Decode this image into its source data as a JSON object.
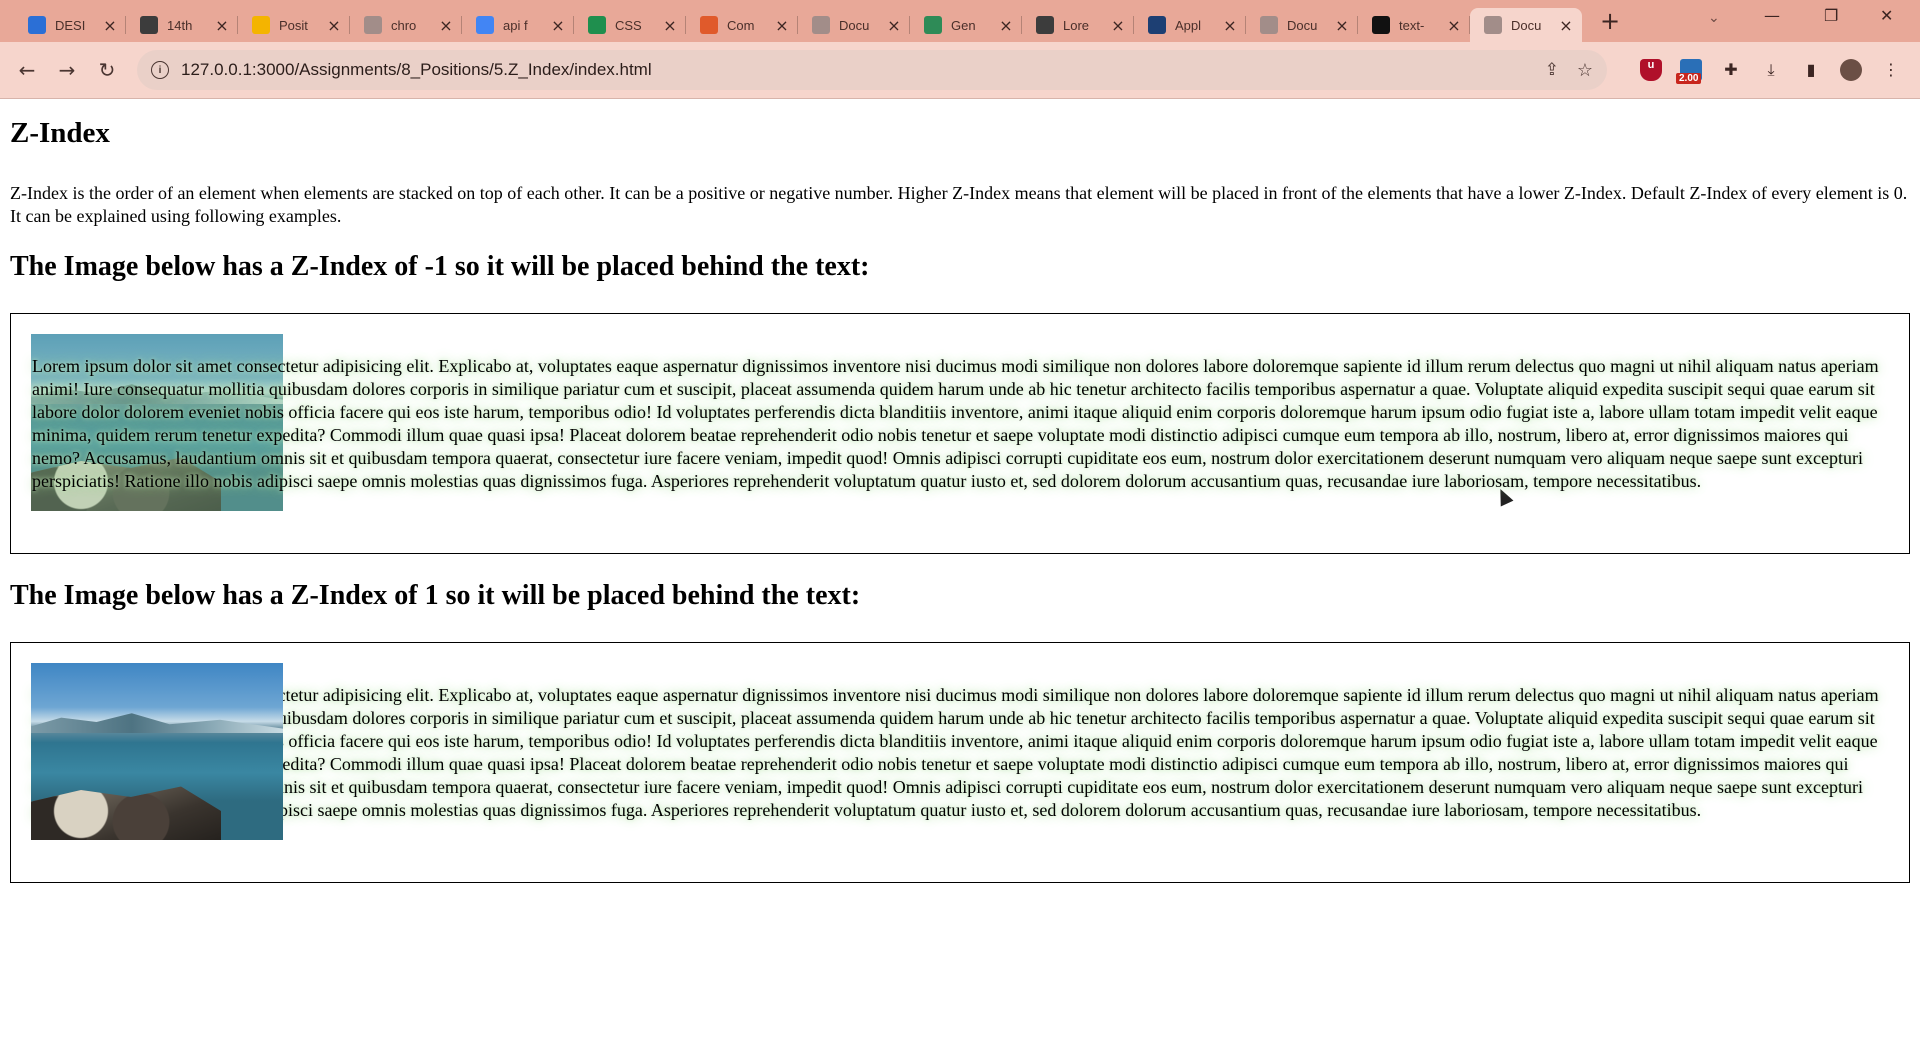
{
  "browser": {
    "tabs": [
      {
        "label": "DESI",
        "icon": "desi-favicon-icon",
        "color": "#2b6fd6"
      },
      {
        "label": "14th",
        "icon": "wordpress-favicon-icon",
        "color": "#3c3c3c"
      },
      {
        "label": "Posit",
        "icon": "google-drive-favicon-icon",
        "color": "#f4b400"
      },
      {
        "label": "chro",
        "icon": "globe-favicon-icon",
        "color": "#a28d89"
      },
      {
        "label": "api f",
        "icon": "google-favicon-icon",
        "color": "#4285f4"
      },
      {
        "label": "CSS",
        "icon": "w3schools-favicon-icon",
        "color": "#1f8f4e"
      },
      {
        "label": "Com",
        "icon": "microsoft-favicon-icon",
        "color": "#e05a2b"
      },
      {
        "label": "Docu",
        "icon": "globe-favicon-icon",
        "color": "#a28d89"
      },
      {
        "label": "Gen",
        "icon": "generator-favicon-icon",
        "color": "#2e8b57"
      },
      {
        "label": "Lore",
        "icon": "image-favicon-icon",
        "color": "#3c3c3c"
      },
      {
        "label": "Appl",
        "icon": "app-favicon-icon",
        "color": "#1d3f73"
      },
      {
        "label": "Docu",
        "icon": "globe-favicon-icon",
        "color": "#a28d89"
      },
      {
        "label": "text-",
        "icon": "medium-favicon-icon",
        "color": "#111111"
      },
      {
        "label": "Docu",
        "icon": "globe-favicon-icon",
        "color": "#a28d89",
        "active": true
      }
    ],
    "address": "127.0.0.1:3000/Assignments/8_Positions/5.Z_Index/index.html",
    "speed_badge": "2.00"
  },
  "page": {
    "title": "Z-Index",
    "intro": "Z-Index is the order of an element when elements are stacked on top of each other. It can be a positive or negative number. Higher Z-Index means that element will be placed in front of the elements that have a lower Z-Index. Default Z-Index of every element is 0. It can be explained using following examples.",
    "section1_heading": "The Image below has a Z-Index of -1 so it will be placed behind the text:",
    "section2_heading": "The Image below has a Z-Index of 1 so it will be placed behind the text:",
    "lorem": "Lorem ipsum dolor sit amet consectetur adipisicing elit. Explicabo at, voluptates eaque aspernatur dignissimos inventore nisi ducimus modi similique non dolores labore doloremque sapiente id illum rerum delectus quo magni ut nihil aliquam natus aperiam animi! Iure consequatur mollitia quibusdam dolores corporis in similique pariatur cum et suscipit, placeat assumenda quidem harum unde ab hic tenetur architecto facilis temporibus aspernatur a quae. Voluptate aliquid expedita suscipit sequi quae earum sit labore dolor dolorem eveniet nobis officia facere qui eos iste harum, temporibus odio! Id voluptates perferendis dicta blanditiis inventore, animi itaque aliquid enim corporis doloremque harum ipsum odio fugiat iste a, labore ullam totam impedit velit eaque minima, quidem rerum tenetur expedita? Commodi illum quae quasi ipsa! Placeat dolorem beatae reprehenderit odio nobis tenetur et saepe voluptate modi distinctio adipisci cumque eum tempora ab illo, nostrum, libero at, error dignissimos maiores qui nemo? Accusamus, laudantium omnis sit et quibusdam tempora quaerat, consectetur iure facere veniam, impedit quod! Omnis adipisci corrupti cupiditate eos eum, nostrum dolor exercitationem deserunt numquam vero aliquam neque saepe sunt excepturi perspiciatis! Ratione illo nobis adipisci saepe omnis molestias quas dignissimos fuga. Asperiores reprehenderit voluptatum quatur iusto et, sed dolorem dolorum accusantium quas, recusandae iure laboriosam, tempore necessitatibus."
  }
}
